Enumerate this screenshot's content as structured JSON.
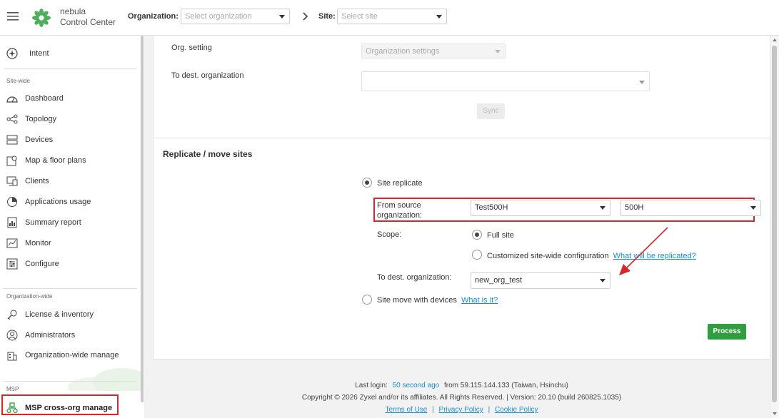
{
  "brand": {
    "line1": "nebula",
    "line2": "Control Center"
  },
  "topbar": {
    "org_label": "Organization:",
    "org_placeholder": "Select organization",
    "site_label": "Site:",
    "site_placeholder": "Select site"
  },
  "sidebar": {
    "intent": "Intent",
    "site_wide_header": "Site-wide",
    "site_wide_items": [
      {
        "label": "Dashboard",
        "icon": "dashboard-icon"
      },
      {
        "label": "Topology",
        "icon": "topology-icon"
      },
      {
        "label": "Devices",
        "icon": "devices-icon"
      },
      {
        "label": "Map & floor plans",
        "icon": "map-icon"
      },
      {
        "label": "Clients",
        "icon": "clients-icon"
      },
      {
        "label": "Applications usage",
        "icon": "pie-chart-icon"
      },
      {
        "label": "Summary report",
        "icon": "report-icon"
      },
      {
        "label": "Monitor",
        "icon": "monitor-icon"
      },
      {
        "label": "Configure",
        "icon": "configure-icon"
      }
    ],
    "org_wide_header": "Organization-wide",
    "org_wide_items": [
      {
        "label": "License & inventory",
        "icon": "license-icon"
      },
      {
        "label": "Administrators",
        "icon": "administrators-icon"
      },
      {
        "label": "Organization-wide manage",
        "icon": "org-manage-icon"
      }
    ],
    "msp_header": "MSP",
    "msp_item": "MSP cross-org manage"
  },
  "sync_section": {
    "org_setting_label": "Org. setting",
    "org_setting_value": "Organization settings",
    "dest_org_label": "To dest. organization",
    "sync_button": "Sync"
  },
  "replicate": {
    "title": "Replicate / move sites",
    "site_replicate_label": "Site replicate",
    "source_org_label_1": "From source",
    "source_org_label_2": "organization:",
    "source_org_value": "Test500H",
    "source_site_value": "500H",
    "scope_label": "Scope:",
    "full_site_label": "Full site",
    "customized_label": "Customized site-wide configuration",
    "what_replicated_link": "What will be replicated?",
    "dest_org_label": "To dest. organization:",
    "dest_org_value": "new_org_test",
    "site_move_label": "Site move with devices",
    "what_is_it_link": "What is it?",
    "process_button": "Process"
  },
  "footer": {
    "last_login_label": "Last login:",
    "last_login_ago": "50 second ago",
    "last_login_from": "from 59.115.144.133 (Taiwan, Hsinchu)",
    "copyright": "Copyright © 2026 Zyxel and/or its affiliates. All Rights Reserved. | Version: 20.10 (build 260825.1035)",
    "terms": "Terms of Use",
    "privacy": "Privacy Policy",
    "cookie": "Cookie Policy"
  },
  "colors": {
    "accent_green": "#2e9e3e",
    "link_blue": "#1a8ed6",
    "highlight_red": "#d9262b"
  }
}
